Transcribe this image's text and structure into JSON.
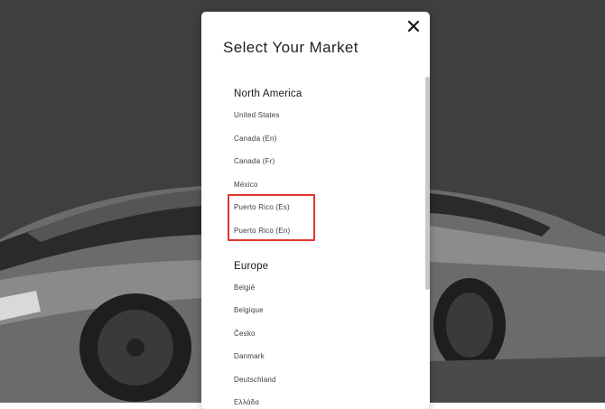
{
  "modal": {
    "title": "Select Your Market",
    "close_icon": "close-icon"
  },
  "regions": [
    {
      "name": "North America",
      "markets": [
        "United States",
        "Canada (En)",
        "Canada (Fr)",
        "México",
        "Puerto Rico (Es)",
        "Puerto Rico (En)"
      ]
    },
    {
      "name": "Europe",
      "markets": [
        "België",
        "Belgique",
        "Česko",
        "Danmark",
        "Deutschland",
        "Ελλάδα"
      ]
    }
  ],
  "highlight": {
    "color": "#e3342f",
    "markets": [
      "Puerto Rico (Es)",
      "Puerto Rico (En)"
    ]
  },
  "colors": {
    "backdrop": "#3f3f3f",
    "modal": "#ffffff"
  }
}
